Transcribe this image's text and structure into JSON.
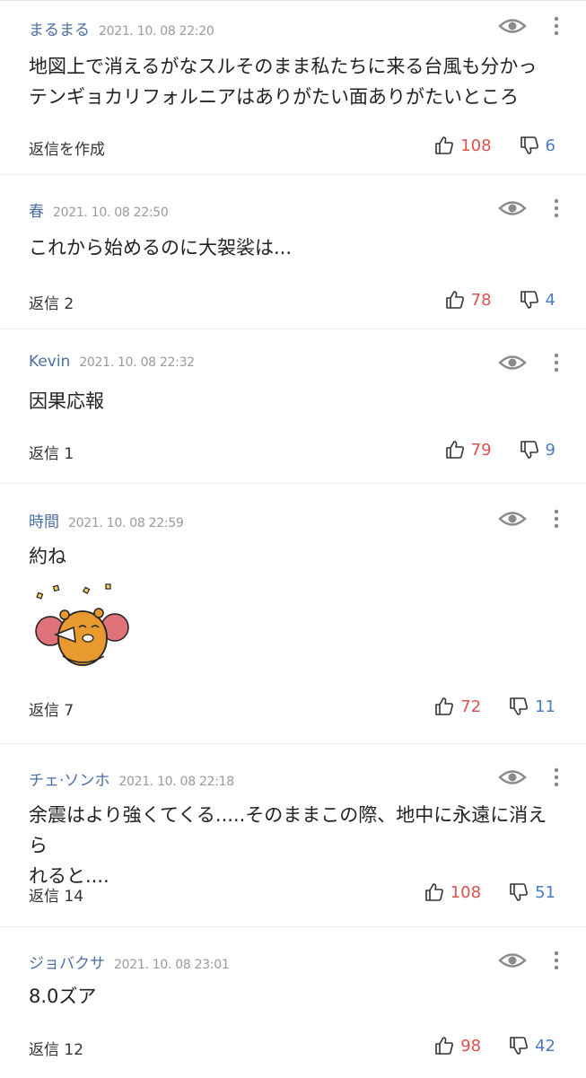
{
  "comments": [
    {
      "author": "まるまる",
      "date": "2021. 10. 08 22:20",
      "lines": [
        "地図上で消えるがなスルそのまま私たちに来る台風も分かっ",
        "テンギョカリフォルニアはありがたい面ありがたいところ"
      ],
      "reply": "返信を作成",
      "likes": "108",
      "dislikes": "6"
    },
    {
      "author": "春",
      "date": "2021. 10. 08 22:50",
      "lines": [
        "これから始めるのに大袈裟は..."
      ],
      "reply": "返信 2",
      "likes": "78",
      "dislikes": "4"
    },
    {
      "author": "Kevin",
      "date": "2021. 10. 08 22:32",
      "lines": [
        "因果応報"
      ],
      "reply": "返信 1",
      "likes": "79",
      "dislikes": "9"
    },
    {
      "author": "時間",
      "date": "2021. 10. 08 22:59",
      "lines": [
        "約ね"
      ],
      "reply": "返信 7",
      "likes": "72",
      "dislikes": "11"
    },
    {
      "author": "チェ·ソンホ",
      "date": "2021. 10. 08 22:18",
      "lines": [
        "余震はより強くてくる.....そのままこの際、地中に永遠に消えら",
        "れると...."
      ],
      "reply": "返信 14",
      "likes": "108",
      "dislikes": "51"
    },
    {
      "author": "ジョバクサ",
      "date": "2021. 10. 08 23:01",
      "lines": [
        "8.0ズア"
      ],
      "reply": "返信 12",
      "likes": "98",
      "dislikes": "42"
    }
  ],
  "icons": {
    "view": "eye-icon",
    "menu": "more-vertical-icon",
    "like": "thumbs-up-icon",
    "dislike": "thumbs-down-icon",
    "sticker": "cheering-character-sticker"
  },
  "colors": {
    "author": "#4a6fa5",
    "like": "#d9534f",
    "dislike": "#4a7bc4"
  }
}
